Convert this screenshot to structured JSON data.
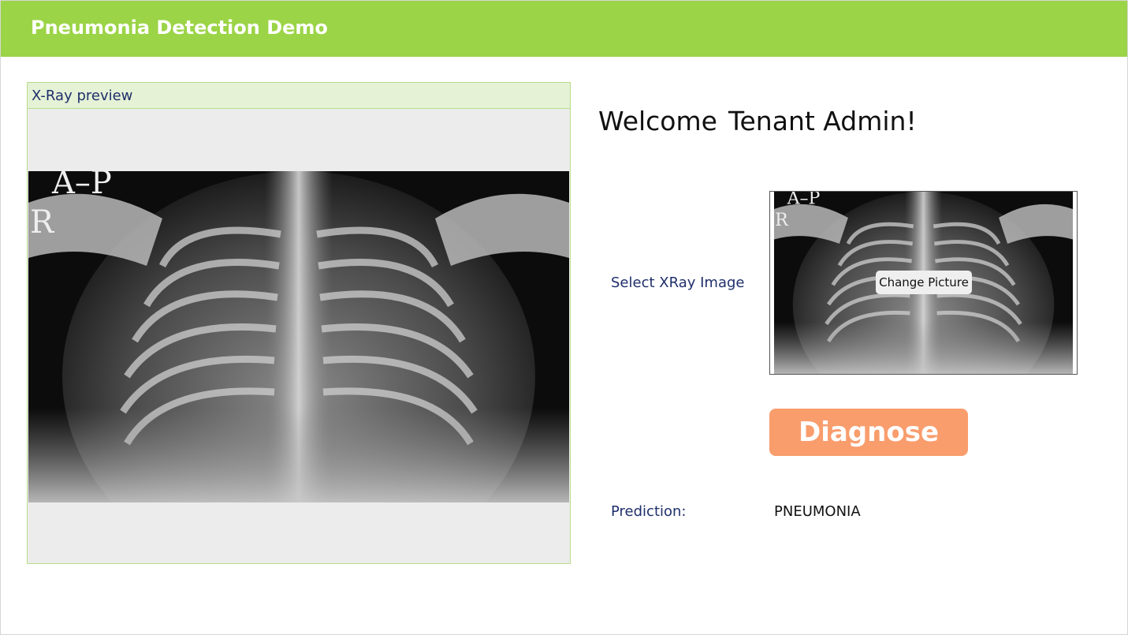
{
  "app": {
    "title": "Pneumonia Detection Demo",
    "header_color": "#9bd446"
  },
  "preview": {
    "title": "X-Ray preview",
    "image": "chest-xray",
    "overlay_text_top": "A–P",
    "overlay_text_side": "R"
  },
  "welcome": {
    "greeting": "Welcome",
    "user_name": "Tenant Admin!"
  },
  "select": {
    "label": "Select XRay Image",
    "change_button": "Change Picture",
    "image": "chest-xray"
  },
  "actions": {
    "diagnose_label": "Diagnose",
    "diagnose_color": "#f99d6d"
  },
  "prediction": {
    "label": "Prediction:",
    "value": "PNEUMONIA"
  }
}
